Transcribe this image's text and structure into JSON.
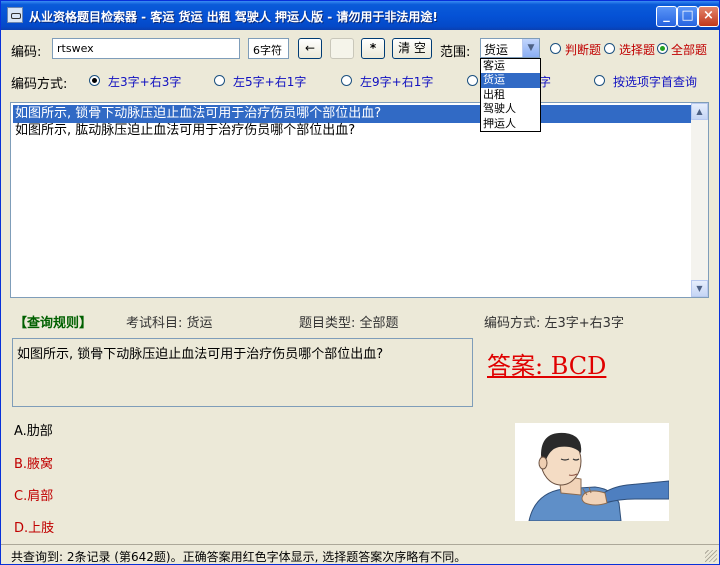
{
  "window": {
    "title": "从业资格题目检索器 - 客运 货运 出租 驾驶人 押运人版 - 请勿用于非法用途!",
    "min_label": "_",
    "max_label": "□",
    "close_label": "×"
  },
  "toolbar": {
    "code_label": "编码:",
    "code_value": "rtswex",
    "char_count": "6字符",
    "backspace_label": "←",
    "blank_label": "",
    "star_label": "*",
    "clear_label": "清 空",
    "range_label": "范围:",
    "range_selected": "货运",
    "range_options": [
      "客运",
      "货运",
      "出租",
      "驾驶人",
      "押运人"
    ],
    "type_options": [
      {
        "label": "判断题",
        "checked": false
      },
      {
        "label": "选择题",
        "checked": false
      },
      {
        "label": "全部题",
        "checked": true
      }
    ]
  },
  "encoding": {
    "label": "编码方式:",
    "options": [
      {
        "label": "左3字+右3字",
        "checked": true
      },
      {
        "label": "左5字+右1字",
        "checked": false
      },
      {
        "label": "左9字+右1字",
        "checked": false
      },
      {
        "label": "字",
        "checked": false
      },
      {
        "label": "按选项字首查询",
        "checked": false
      }
    ]
  },
  "results": [
    {
      "text": "如图所示, 锁骨下动脉压迫止血法可用于治疗伤员哪个部位出血?",
      "selected": true
    },
    {
      "text": "如图所示, 肱动脉压迫止血法可用于治疗伤员哪个部位出血?",
      "selected": false
    }
  ],
  "query_info": {
    "rules_label": "【查询规则】",
    "subject": "考试科目: 货运",
    "question_type": "题目类型: 全部题",
    "encoding_mode": "编码方式: 左3字+右3字"
  },
  "question": {
    "text": "如图所示, 锁骨下动脉压迫止血法可用于治疗伤员哪个部位出血?",
    "answer": "答案: BCD",
    "options": [
      {
        "label": "A.肋部",
        "correct": false
      },
      {
        "label": "B.腋窝",
        "correct": true
      },
      {
        "label": "C.肩部",
        "correct": true
      },
      {
        "label": "D.上肢",
        "correct": true
      }
    ]
  },
  "status": {
    "text": "共查询到: 2条记录 (第642题)。正确答案用红色字体显示, 选择题答案次序略有不同。"
  },
  "colors": {
    "title_blue": "#0552d6",
    "selection_blue": "#316ac5",
    "answer_red": "#e00000",
    "correct_option_red": "#c00000",
    "rules_green": "#006000"
  }
}
